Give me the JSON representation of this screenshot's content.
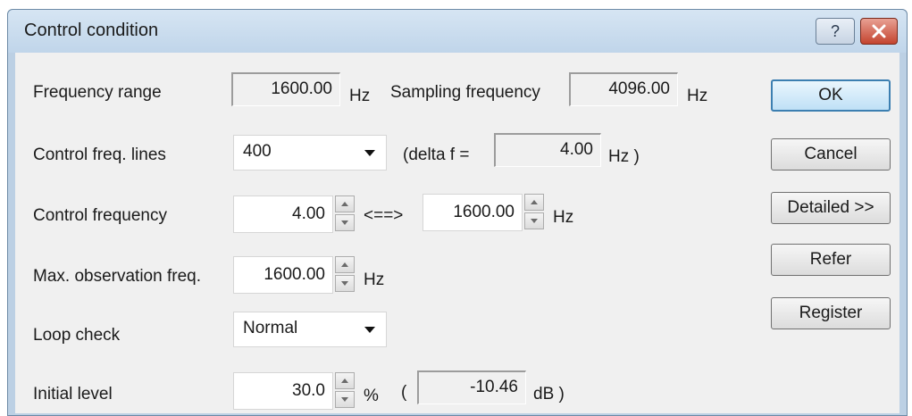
{
  "window": {
    "title": "Control condition",
    "help_glyph": "?"
  },
  "icons": {
    "help": "question-mark-icon",
    "close": "close-x-icon",
    "dropdown": "dropdown-arrow-icon"
  },
  "colors": {
    "close_button": "#c4442f",
    "default_button_border": "#3c7fb1",
    "dialog_bg": "#f0f0f0"
  },
  "frequency_range": {
    "label": "Frequency range",
    "value": "1600.00",
    "unit": "Hz"
  },
  "sampling_frequency": {
    "label": "Sampling frequency",
    "value": "4096.00",
    "unit": "Hz"
  },
  "control_freq_lines": {
    "label": "Control freq. lines",
    "selected": "400"
  },
  "delta_f": {
    "prefix": "(delta f =",
    "value": "4.00",
    "unit": "Hz )"
  },
  "control_frequency": {
    "label": "Control frequency",
    "low": "4.00",
    "separator": "<==>",
    "high": "1600.00",
    "unit": "Hz"
  },
  "max_observation_freq": {
    "label": "Max. observation freq.",
    "value": "1600.00",
    "unit": "Hz"
  },
  "loop_check": {
    "label": "Loop check",
    "selected": "Normal"
  },
  "initial_level": {
    "label": "Initial level",
    "value": "30.0",
    "unit": "%",
    "paren_open": "(",
    "db_value": "-10.46",
    "db_unit": "dB )"
  },
  "buttons": {
    "ok": "OK",
    "cancel": "Cancel",
    "detailed": "Detailed >>",
    "refer": "Refer",
    "register": "Register"
  }
}
